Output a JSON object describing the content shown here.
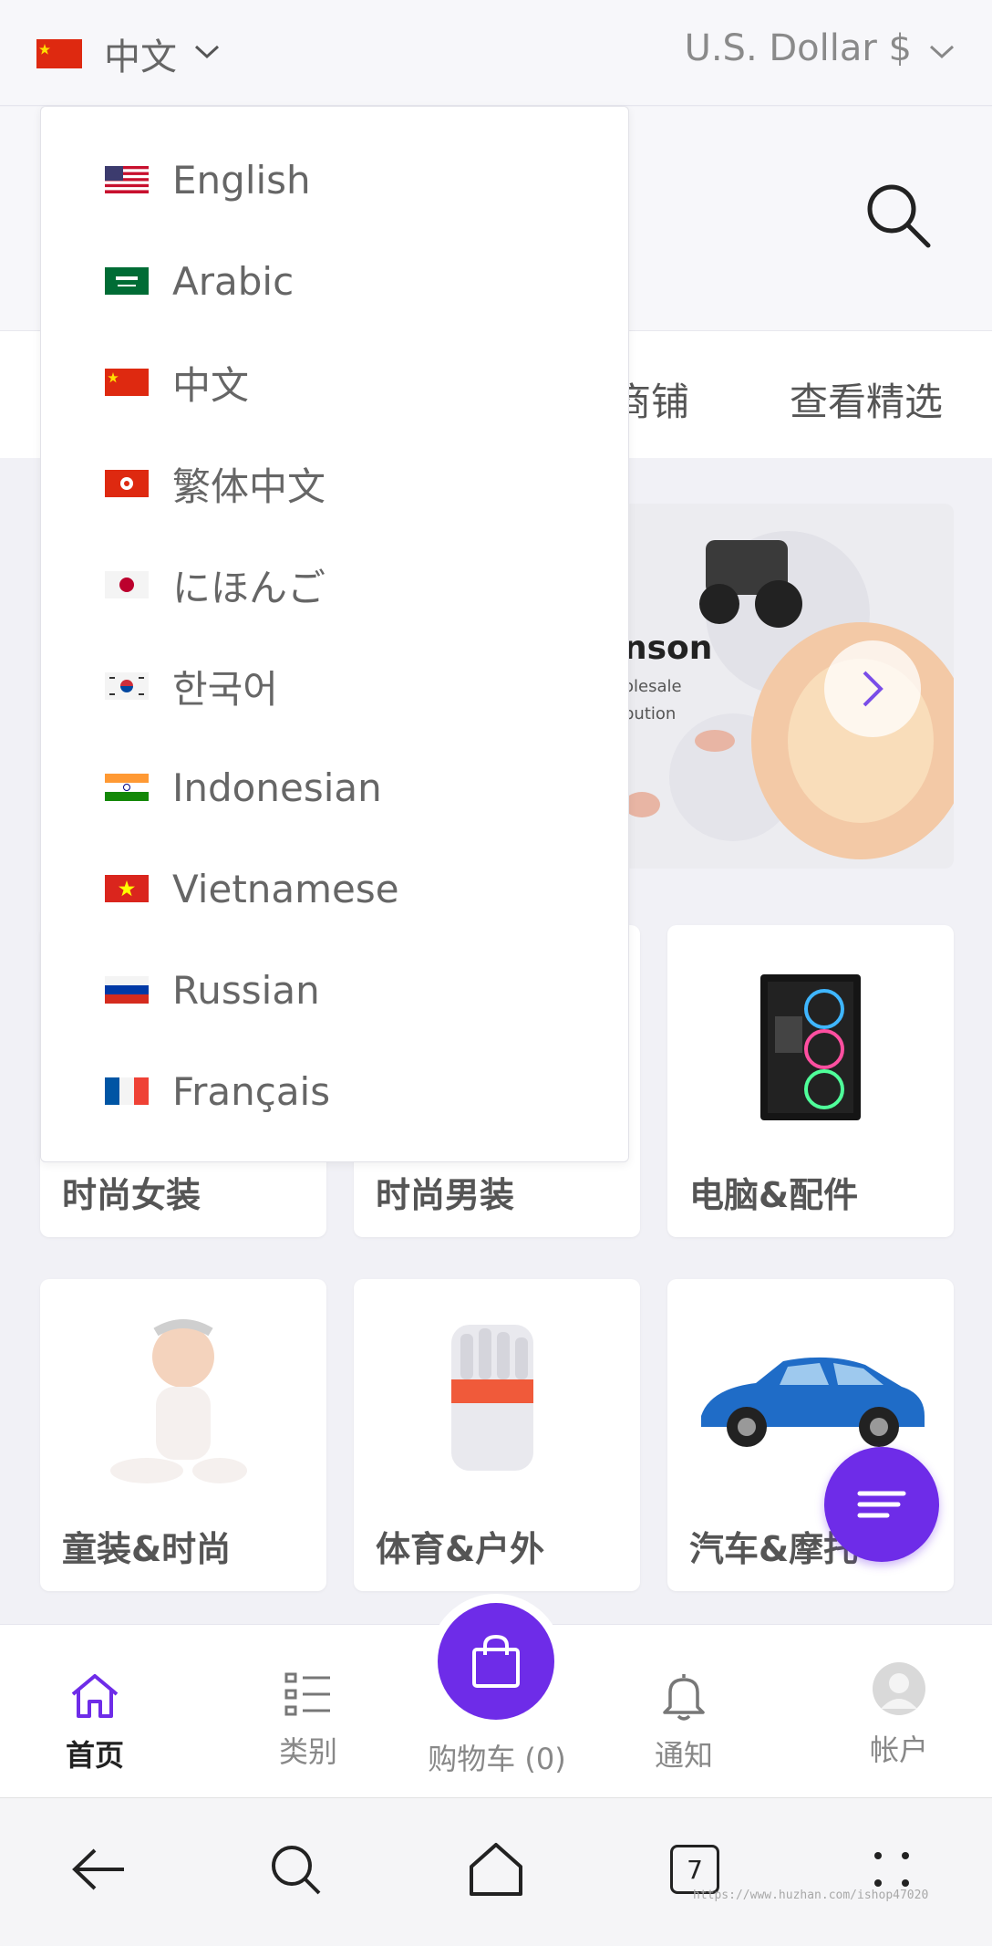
{
  "topbar": {
    "language_current": "中文",
    "currency": "U.S. Dollar $"
  },
  "header": {
    "nav_tabs": [
      "商铺",
      "查看精选"
    ]
  },
  "banner": {
    "headline": "nson",
    "line1": "olesale",
    "line2": "bution"
  },
  "language_menu": [
    {
      "label": "English",
      "flag": "us-flag"
    },
    {
      "label": "Arabic",
      "flag": "sa-flag"
    },
    {
      "label": "中文",
      "flag": "cn-flag"
    },
    {
      "label": "繁体中文",
      "flag": "hk-flag"
    },
    {
      "label": "にほんご",
      "flag": "jp-flag"
    },
    {
      "label": "한국어",
      "flag": "kr-flag"
    },
    {
      "label": "Indonesian",
      "flag": "in-flag"
    },
    {
      "label": "Vietnamese",
      "flag": "vn-flag"
    },
    {
      "label": "Russian",
      "flag": "ru-flag"
    },
    {
      "label": "Français",
      "flag": "fr-flag"
    }
  ],
  "categories": [
    {
      "label": "时尚女装"
    },
    {
      "label": "时尚男装"
    },
    {
      "label": "电脑&配件"
    },
    {
      "label": "童装&时尚"
    },
    {
      "label": "体育&户外"
    },
    {
      "label": "汽车&摩托"
    }
  ],
  "bottom_nav": {
    "home": "首页",
    "categories": "类别",
    "cart": "购物车 (0)",
    "notifications": "通知",
    "account": "帐户"
  },
  "browser": {
    "tab_count": "7"
  },
  "watermark": "https://www.huzhan.com/ishop47020",
  "colors": {
    "accent": "#6e2ce8",
    "background": "#f1f1f6"
  }
}
